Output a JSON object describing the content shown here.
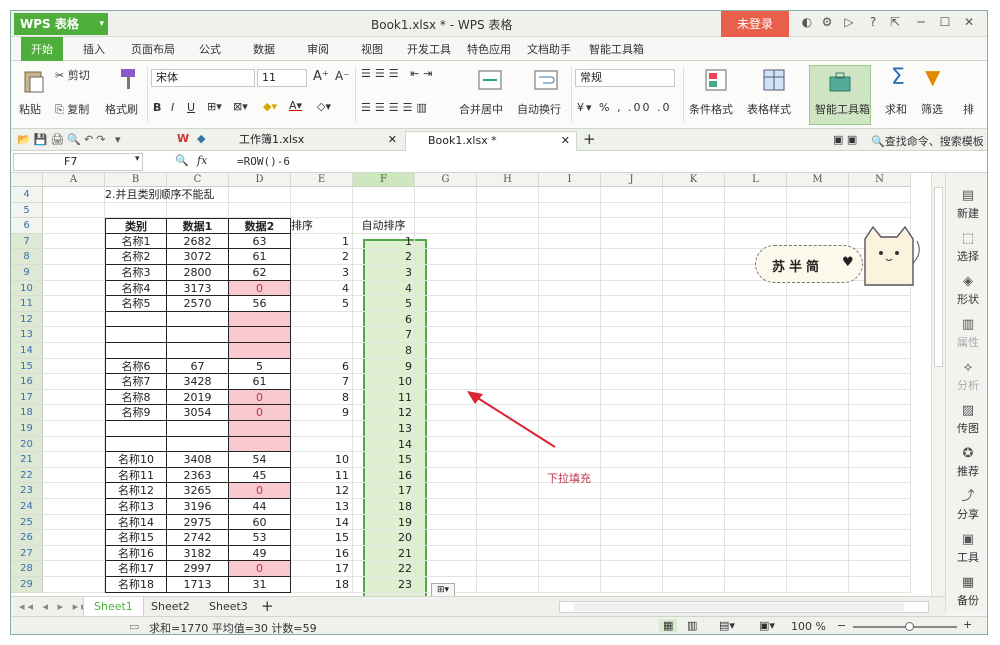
{
  "app": {
    "menu_button": "WPS 表格",
    "title": "Book1.xlsx * - WPS 表格",
    "login": "未登录"
  },
  "tabs": [
    "开始",
    "插入",
    "页面布局",
    "公式",
    "数据",
    "审阅",
    "视图",
    "开发工具",
    "特色应用",
    "文档助手",
    "智能工具箱"
  ],
  "ribbon": {
    "paste": "粘贴",
    "cut": "剪切",
    "copy": "复制",
    "format_painter": "格式刷",
    "font_name": "宋体",
    "font_size": "11",
    "merge_center": "合并居中",
    "wrap_text": "自动换行",
    "number_format": "常规",
    "conditional_format": "条件格式",
    "table_style": "表格样式",
    "smart_toolbox": "智能工具箱",
    "sum": "求和",
    "filter": "筛选",
    "sort": "排"
  },
  "doc_tabs": [
    {
      "name": "工作簿1.xlsx"
    },
    {
      "name": "Book1.xlsx *"
    }
  ],
  "search_command": "查找命令、搜索模板",
  "formula_bar": {
    "name_box": "F7",
    "fx": "fx",
    "formula": "=ROW()-6"
  },
  "columns": [
    "A",
    "B",
    "C",
    "D",
    "E",
    "F",
    "G",
    "H",
    "I",
    "J",
    "K",
    "L",
    "M",
    "N"
  ],
  "rows": [
    "4",
    "5",
    "6",
    "7",
    "8",
    "9",
    "10",
    "11",
    "12",
    "13",
    "14",
    "15",
    "16",
    "17",
    "18",
    "19",
    "20",
    "21",
    "22",
    "23",
    "24",
    "25",
    "26",
    "27",
    "28",
    "29"
  ],
  "sheet": {
    "note_row4": "2.并且类别顺序不能乱",
    "headers": {
      "category": "类别",
      "data1": "数据1",
      "data2": "数据2",
      "sort": "排序",
      "auto_sort": "自动排序"
    },
    "data_rows": [
      {
        "name": "名称1",
        "d1": "2682",
        "d2": "63",
        "sort": "1",
        "auto": "1",
        "pink": false
      },
      {
        "name": "名称2",
        "d1": "3072",
        "d2": "61",
        "sort": "2",
        "auto": "2",
        "pink": false
      },
      {
        "name": "名称3",
        "d1": "2800",
        "d2": "62",
        "sort": "3",
        "auto": "3",
        "pink": false
      },
      {
        "name": "名称4",
        "d1": "3173",
        "d2": "0",
        "sort": "4",
        "auto": "4",
        "pink": true
      },
      {
        "name": "名称5",
        "d1": "2570",
        "d2": "56",
        "sort": "5",
        "auto": "5",
        "pink": false
      },
      {
        "name": "",
        "d1": "",
        "d2": "",
        "sort": "",
        "auto": "6",
        "pink": true
      },
      {
        "name": "",
        "d1": "",
        "d2": "",
        "sort": "",
        "auto": "7",
        "pink": true
      },
      {
        "name": "",
        "d1": "",
        "d2": "",
        "sort": "",
        "auto": "8",
        "pink": true
      },
      {
        "name": "名称6",
        "d1": "67",
        "d2": "5",
        "sort": "6",
        "auto": "9",
        "pink": false
      },
      {
        "name": "名称7",
        "d1": "3428",
        "d2": "61",
        "sort": "7",
        "auto": "10",
        "pink": false
      },
      {
        "name": "名称8",
        "d1": "2019",
        "d2": "0",
        "sort": "8",
        "auto": "11",
        "pink": true
      },
      {
        "name": "名称9",
        "d1": "3054",
        "d2": "0",
        "sort": "9",
        "auto": "12",
        "pink": true
      },
      {
        "name": "",
        "d1": "",
        "d2": "",
        "sort": "",
        "auto": "13",
        "pink": true
      },
      {
        "name": "",
        "d1": "",
        "d2": "",
        "sort": "",
        "auto": "14",
        "pink": true
      },
      {
        "name": "名称10",
        "d1": "3408",
        "d2": "54",
        "sort": "10",
        "auto": "15",
        "pink": false
      },
      {
        "name": "名称11",
        "d1": "2363",
        "d2": "45",
        "sort": "11",
        "auto": "16",
        "pink": false
      },
      {
        "name": "名称12",
        "d1": "3265",
        "d2": "0",
        "sort": "12",
        "auto": "17",
        "pink": true
      },
      {
        "name": "名称13",
        "d1": "3196",
        "d2": "44",
        "sort": "13",
        "auto": "18",
        "pink": false
      },
      {
        "name": "名称14",
        "d1": "2975",
        "d2": "60",
        "sort": "14",
        "auto": "19",
        "pink": false
      },
      {
        "name": "名称15",
        "d1": "2742",
        "d2": "53",
        "sort": "15",
        "auto": "20",
        "pink": false
      },
      {
        "name": "名称16",
        "d1": "3182",
        "d2": "49",
        "sort": "16",
        "auto": "21",
        "pink": false
      },
      {
        "name": "名称17",
        "d1": "2997",
        "d2": "0",
        "sort": "17",
        "auto": "22",
        "pink": true
      },
      {
        "name": "名称18",
        "d1": "1713",
        "d2": "31",
        "sort": "18",
        "auto": "23",
        "pink": false
      }
    ],
    "annotation": "下拉填充",
    "sticker": "苏半简"
  },
  "right_panel": [
    {
      "label": "新建",
      "icon": "new-icon",
      "dim": false
    },
    {
      "label": "选择",
      "icon": "select-icon",
      "dim": false
    },
    {
      "label": "形状",
      "icon": "shape-icon",
      "dim": false
    },
    {
      "label": "属性",
      "icon": "property-icon",
      "dim": true
    },
    {
      "label": "分析",
      "icon": "analyze-icon",
      "dim": true
    },
    {
      "label": "传图",
      "icon": "upload-image-icon",
      "dim": false
    },
    {
      "label": "推荐",
      "icon": "recommend-icon",
      "dim": false
    },
    {
      "label": "分享",
      "icon": "share-icon",
      "dim": false
    },
    {
      "label": "工具",
      "icon": "toolbox-icon",
      "dim": false
    },
    {
      "label": "备份",
      "icon": "backup-icon",
      "dim": false
    }
  ],
  "sheets": [
    "Sheet1",
    "Sheet2",
    "Sheet3"
  ],
  "status": {
    "summary": "求和=1770  平均值=30  计数=59",
    "zoom": "100 %"
  },
  "colors": {
    "accent": "#4eae3c",
    "login": "#e8604c",
    "pink": "#f9c9d0",
    "fill_green": "#dff0d0"
  }
}
